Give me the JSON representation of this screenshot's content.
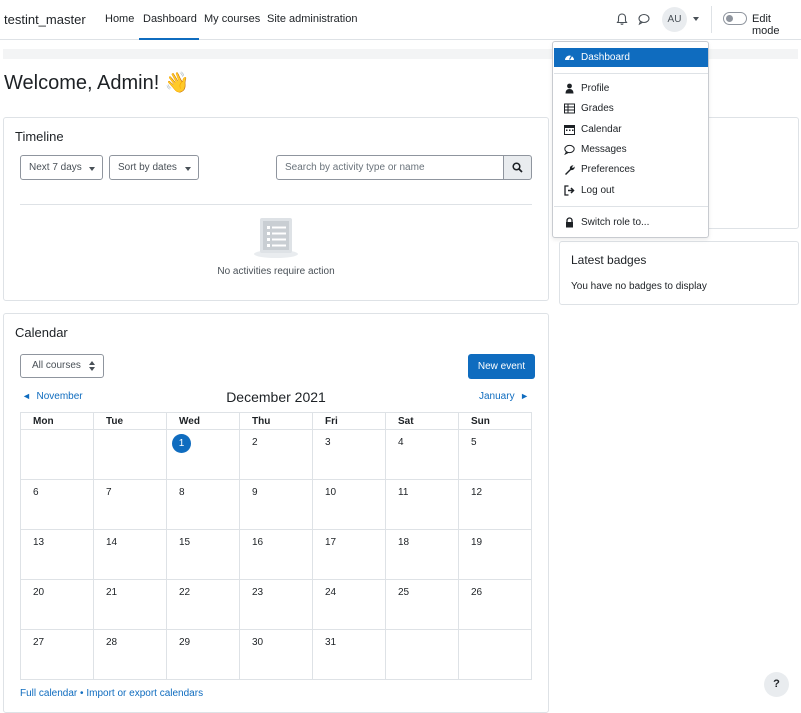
{
  "navbar": {
    "brand": "testint_master",
    "links": [
      "Home",
      "Dashboard",
      "My courses",
      "Site administration"
    ],
    "active_link": "Dashboard",
    "avatar_initials": "AU",
    "edit_mode_label": "Edit mode",
    "edit_mode_on": false,
    "icons": [
      "bell-icon",
      "chat-icon"
    ]
  },
  "page": {
    "welcome": "Welcome, Admin! 👋"
  },
  "timeline": {
    "title": "Timeline",
    "filter_label": "Next 7 days",
    "sort_label": "Sort by dates",
    "search_placeholder": "Search by activity type or name",
    "empty_message": "No activities require action"
  },
  "calendar": {
    "title": "Calendar",
    "course_select": "All courses",
    "new_event_label": "New event",
    "prev_month": "November",
    "next_month": "January",
    "month_title": "December 2021",
    "weekdays": [
      "Mon",
      "Tue",
      "Wed",
      "Thu",
      "Fri",
      "Sat",
      "Sun"
    ],
    "weeks": [
      [
        "",
        "",
        "1",
        "2",
        "3",
        "4",
        "5"
      ],
      [
        "6",
        "7",
        "8",
        "9",
        "10",
        "11",
        "12"
      ],
      [
        "13",
        "14",
        "15",
        "16",
        "17",
        "18",
        "19"
      ],
      [
        "20",
        "21",
        "22",
        "23",
        "24",
        "25",
        "26"
      ],
      [
        "27",
        "28",
        "29",
        "30",
        "31",
        "",
        ""
      ]
    ],
    "today": "1",
    "full_calendar_link": "Full calendar",
    "separator": "•",
    "import_export_link": "Import or export calendars"
  },
  "user_menu": {
    "items": [
      {
        "label": "Dashboard",
        "icon": "dashboard-icon",
        "active": true
      },
      {
        "label": "Profile",
        "icon": "user-icon"
      },
      {
        "label": "Grades",
        "icon": "table-icon"
      },
      {
        "label": "Calendar",
        "icon": "calendar-icon"
      },
      {
        "label": "Messages",
        "icon": "chat-icon"
      },
      {
        "label": "Preferences",
        "icon": "wrench-icon"
      },
      {
        "label": "Log out",
        "icon": "sign-out-icon"
      },
      {
        "label": "Switch role to...",
        "icon": "lock-icon"
      }
    ]
  },
  "badges": {
    "title": "Latest badges",
    "message": "You have no badges to display"
  },
  "help": {
    "label": "?"
  },
  "colors": {
    "accent": "#0f6cbf",
    "border": "#dee2e6"
  }
}
